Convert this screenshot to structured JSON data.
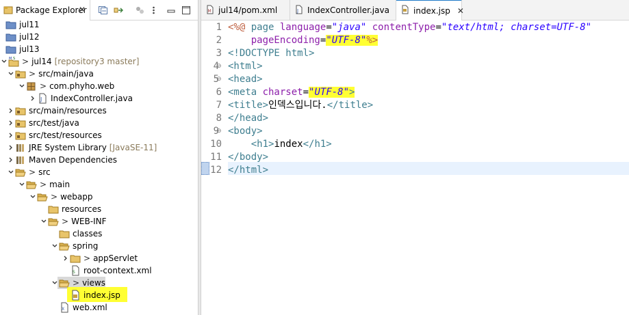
{
  "package_explorer": {
    "title": "Package Explorer",
    "close": "✕",
    "tree": [
      {
        "label": "jul11"
      },
      {
        "label": "jul12"
      },
      {
        "label": "jul13"
      },
      {
        "label": "jul14",
        "prefix": ">",
        "decoration": "[repository3 master]"
      },
      {
        "label": "src/main/java",
        "prefix": ">"
      },
      {
        "label": "com.phyho.web",
        "prefix": ">"
      },
      {
        "label": "IndexController.java"
      },
      {
        "label": "src/main/resources"
      },
      {
        "label": "src/test/java"
      },
      {
        "label": "src/test/resources"
      },
      {
        "label": "JRE System Library",
        "decoration": "[JavaSE-11]"
      },
      {
        "label": "Maven Dependencies"
      },
      {
        "label": "src",
        "prefix": ">"
      },
      {
        "label": "main",
        "prefix": ">"
      },
      {
        "label": "webapp",
        "prefix": ">"
      },
      {
        "label": "resources"
      },
      {
        "label": "WEB-INF",
        "prefix": ">"
      },
      {
        "label": "classes"
      },
      {
        "label": "spring"
      },
      {
        "label": "appServlet",
        "prefix": ">"
      },
      {
        "label": "root-context.xml"
      },
      {
        "label": "views",
        "prefix": ">"
      },
      {
        "label": "index.jsp"
      },
      {
        "label": "web.xml"
      }
    ]
  },
  "editor": {
    "tabs": [
      {
        "label": "jul14/pom.xml"
      },
      {
        "label": "IndexController.java"
      },
      {
        "label": "index.jsp",
        "close": "✕"
      }
    ],
    "line_numbers": [
      "1",
      "2",
      "3",
      "4",
      "5",
      "6",
      "7",
      "8",
      "9",
      "10",
      "11",
      "12"
    ],
    "code": {
      "l1_open": "<%@",
      "l1_page": " page ",
      "l1_lang": "language",
      "l1_eq1": "=",
      "l1_lang_val": "\"java\"",
      "l1_ct": " contentType",
      "l1_eq2": "=",
      "l1_ct_val": "\"text/html; charset=UTF-8\"",
      "l2_indent": "    ",
      "l2_pe": "pageEncoding",
      "l2_eq": "=",
      "l2_val": "\"UTF-8\"",
      "l2_close": "%>",
      "l3": "<!DOCTYPE html>",
      "l4": "<html>",
      "l5": "<head>",
      "l6_open": "<meta ",
      "l6_attr": "charset",
      "l6_eq": "=",
      "l6_val": "\"UTF-8\"",
      "l6_close": ">",
      "l7_open": "<title>",
      "l7_text": "인덱스입니다.",
      "l7_close": "</title>",
      "l8": "</head>",
      "l9": "<body>",
      "l10_indent": "    ",
      "l10_open": "<h1>",
      "l10_text": "index",
      "l10_close": "</h1>",
      "l11": "</body>",
      "l12": "</html>"
    }
  },
  "colors": {
    "highlight": "#ffff33",
    "active_tab_accent": "#1e7ac8",
    "tag": "#3e7e8f",
    "attribute": "#8c1eaa",
    "string": "#2a00ff"
  }
}
